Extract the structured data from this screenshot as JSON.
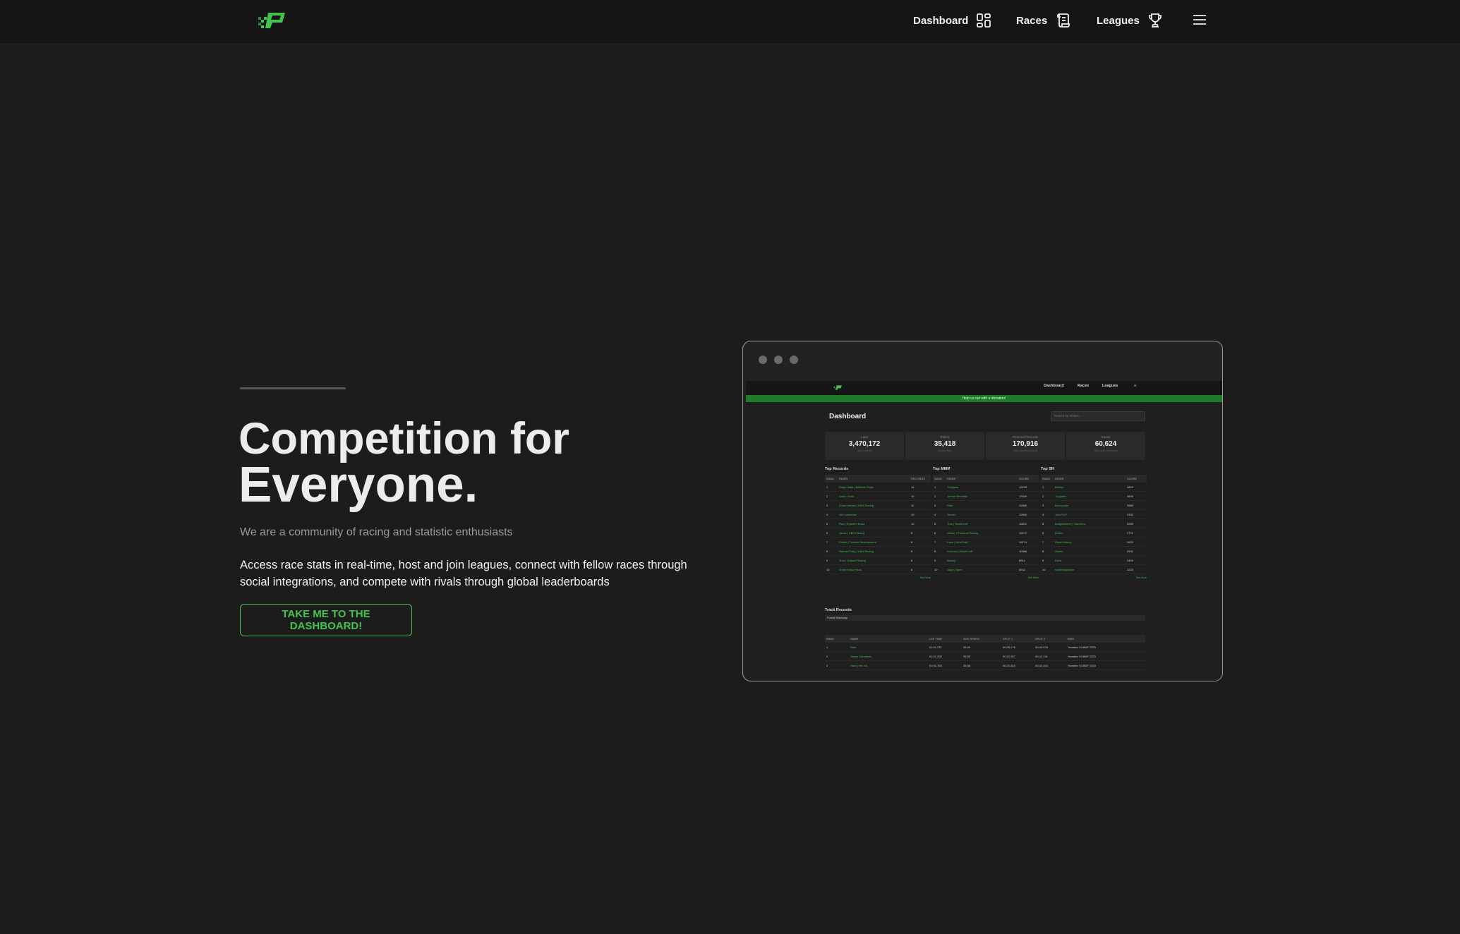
{
  "nav": {
    "items": [
      {
        "label": "Dashboard",
        "icon": "dashboard-grid-icon"
      },
      {
        "label": "Races",
        "icon": "scroll-list-icon"
      },
      {
        "label": "Leagues",
        "icon": "trophy-icon"
      }
    ],
    "menu_icon": "hamburger-menu-icon"
  },
  "hero": {
    "title_line1": "Competition for",
    "title_line2": "Everyone.",
    "subtitle": "We are a community of racing and statistic enthusiasts",
    "description": "Access race stats in real-time, host and join leagues, connect with fellow races through social integrations, and compete with rivals through global leaderboards",
    "cta_label": "TAKE ME TO THE DASHBOARD!"
  },
  "colors": {
    "accent": "#41c34e",
    "background": "#1c1c1d",
    "topbar": "#151516"
  },
  "preview": {
    "nav": [
      "Dashboard",
      "Races",
      "Leagues"
    ],
    "banner": "Help us out with a donation!",
    "title": "Dashboard",
    "search_placeholder": "Search for Riders...",
    "stats": [
      {
        "label": "Laps",
        "value": "3,470,172",
        "caption": "Laps recorded"
      },
      {
        "label": "Riders",
        "value": "35,418",
        "caption": "Unique riders"
      },
      {
        "label": "Personal Records",
        "value": "170,916",
        "caption": "Total personal records"
      },
      {
        "label": "Races",
        "value": "60,624",
        "caption": "Total races completed"
      }
    ],
    "tables": [
      {
        "title": "Top Records",
        "headers": [
          "RANK",
          "RIDER",
          "RECORDS"
        ],
        "rows": [
          [
            "1",
            "Diogo Maia | Artfields Ships",
            "14"
          ],
          [
            "2",
            "Arnie | Hold",
            "14"
          ],
          [
            "3",
            "Zoran Mersel | LMG Racing",
            "11"
          ],
          [
            "4",
            "Jett Lawrence",
            "10"
          ],
          [
            "5",
            "Pica | Eystrem Brust",
            "10"
          ],
          [
            "6",
            "Jacob | SBR Racing",
            "8"
          ],
          [
            "7",
            "Fredel | Trodent Development",
            "8"
          ],
          [
            "8",
            "Nathan Petry | LMG Racing",
            "8"
          ],
          [
            "9",
            "Tres | Vulkant Racing",
            "8"
          ],
          [
            "10",
            "Grant Fabio Hank",
            "8"
          ]
        ],
        "see_more": "See More"
      },
      {
        "title": "Top MMR",
        "headers": [
          "RANK",
          "RIDER",
          "SCORE"
        ],
        "rows": [
          [
            "1",
            "Troyjams",
            "13233"
          ],
          [
            "2",
            "Jordan Bersibbe",
            "12009"
          ],
          [
            "3",
            "Rath",
            "11988"
          ],
          [
            "4",
            "Tanner",
            "11984"
          ],
          [
            "5",
            "Tres | Skmtrocrft",
            "11820"
          ],
          [
            "6",
            "Verkor | Personal Racing",
            "11670"
          ],
          [
            "7",
            "Kaxn | NextCraft",
            "11374"
          ],
          [
            "8",
            "Krevrah | SsectCraft",
            "10568"
          ],
          [
            "9",
            "Binhop",
            "8911"
          ],
          [
            "10",
            "Dave | Apex",
            "8912"
          ]
        ],
        "see_more": "See More"
      },
      {
        "title": "Top SR",
        "headers": [
          "RANK",
          "RIDER",
          "SCORE"
        ],
        "rows": [
          [
            "1",
            "Binhop",
            "3815"
          ],
          [
            "2",
            "Troyjams",
            "3606"
          ],
          [
            "3",
            "Bornsmder",
            "3580"
          ],
          [
            "4",
            "Jack2047",
            "3332"
          ],
          [
            "5",
            "budgetsketer | Thunders",
            "3289"
          ],
          [
            "6",
            "Bridbe",
            "2776"
          ],
          [
            "7",
            "Royal Marmy",
            "2622"
          ],
          [
            "8",
            "Skarts",
            "2532"
          ],
          [
            "9",
            "Huds",
            "2493"
          ],
          [
            "10",
            "shelifettuclimbe",
            "2223"
          ]
        ],
        "see_more": "See More"
      }
    ],
    "track": {
      "title": "Track Records",
      "select": "Forest Raceway",
      "headers": [
        "RANK",
        "NAME",
        "LAP TIME",
        "AVG SPEED",
        "SPLIT 1",
        "SPLIT 2",
        "BIKE"
      ],
      "rows": [
        [
          "1",
          "Rath",
          "01:01.231",
          "35.90",
          "00:25.278",
          "00:42.578",
          "Yamaha YZ450F 2023"
        ],
        [
          "2",
          "Verkor | Anatheis",
          "01:01.266",
          "35.65",
          "00:22.367",
          "00:42.131",
          "Yamaha YZ450F 2023"
        ],
        [
          "3",
          "Hara | eth.HA",
          "01:01.765",
          "35.56",
          "00:23.343",
          "00:42.343",
          "Yamaha YZ450F 2023"
        ]
      ]
    }
  }
}
